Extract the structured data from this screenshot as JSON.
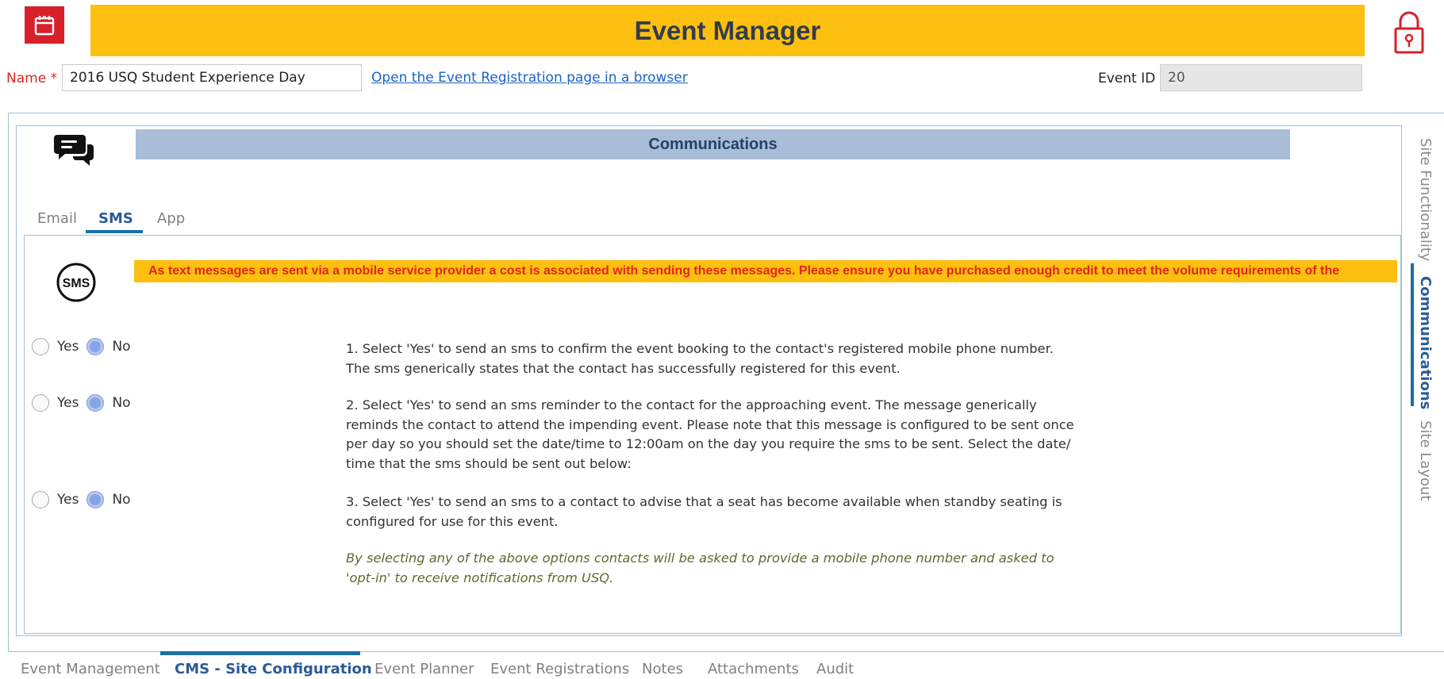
{
  "header": {
    "title": "Event Manager"
  },
  "event": {
    "name_label": "Name",
    "name_required_marker": "*",
    "name_value": "2016 USQ Student Experience Day",
    "open_link": "Open the Event Registration page in a browser",
    "id_label": "Event ID",
    "id_value": "20"
  },
  "section": {
    "title": "Communications"
  },
  "subtabs": [
    {
      "label": "Email",
      "active": false
    },
    {
      "label": "SMS",
      "active": true
    },
    {
      "label": "App",
      "active": false
    }
  ],
  "sms": {
    "warning": "As text messages are sent via a mobile service provider a cost is associated with sending these messages. Please ensure you have purchased enough credit to meet the volume requirements of the",
    "options": [
      {
        "yes_label": "Yes",
        "no_label": "No",
        "selected": "No",
        "description": "1. Select 'Yes' to send an sms to confirm the event booking to the contact's registered mobile phone number. The sms generically states that the contact has successfully registered for this event."
      },
      {
        "yes_label": "Yes",
        "no_label": "No",
        "selected": "No",
        "description": "2. Select 'Yes' to send an sms reminder to the contact for the approaching event. The message generically reminds the contact to attend the impending event. Please note that this message is configured to be sent once per day so you should set the date/time to 12:00am on the day you require the sms to be sent. Select the date/ time that the sms should be sent out below:"
      },
      {
        "yes_label": "Yes",
        "no_label": "No",
        "selected": "No",
        "description": "3. Select 'Yes' to send an sms to a contact to advise that a seat has become available when standby seating is configured for use for this event."
      }
    ],
    "note": "By selecting any of the above options contacts will be asked to provide a mobile phone number and asked to 'opt-in' to receive notifications from USQ."
  },
  "side_tabs": [
    {
      "label": "Site Functionality",
      "active": false
    },
    {
      "label": "Communications",
      "active": true
    },
    {
      "label": "Site Layout",
      "active": false
    }
  ],
  "bottom_tabs": [
    {
      "label": "Event Management",
      "active": false
    },
    {
      "label": "CMS - Site Configuration",
      "active": true
    },
    {
      "label": "Event Planner",
      "active": false
    },
    {
      "label": "Event Registrations",
      "active": false
    },
    {
      "label": "Notes",
      "active": false
    },
    {
      "label": "Attachments",
      "active": false
    },
    {
      "label": "Audit",
      "active": false
    }
  ],
  "colors": {
    "accent_yellow": "#fdc010",
    "brand_red": "#d8202a",
    "section_blue": "#a9bdd7",
    "active_tab_blue": "#1c6fa6",
    "warning_text": "#e0261b"
  },
  "icons": {
    "app": "calendar-icon",
    "lock": "lock-icon",
    "communications": "chat-bubbles-icon",
    "sms": "sms-icon"
  }
}
